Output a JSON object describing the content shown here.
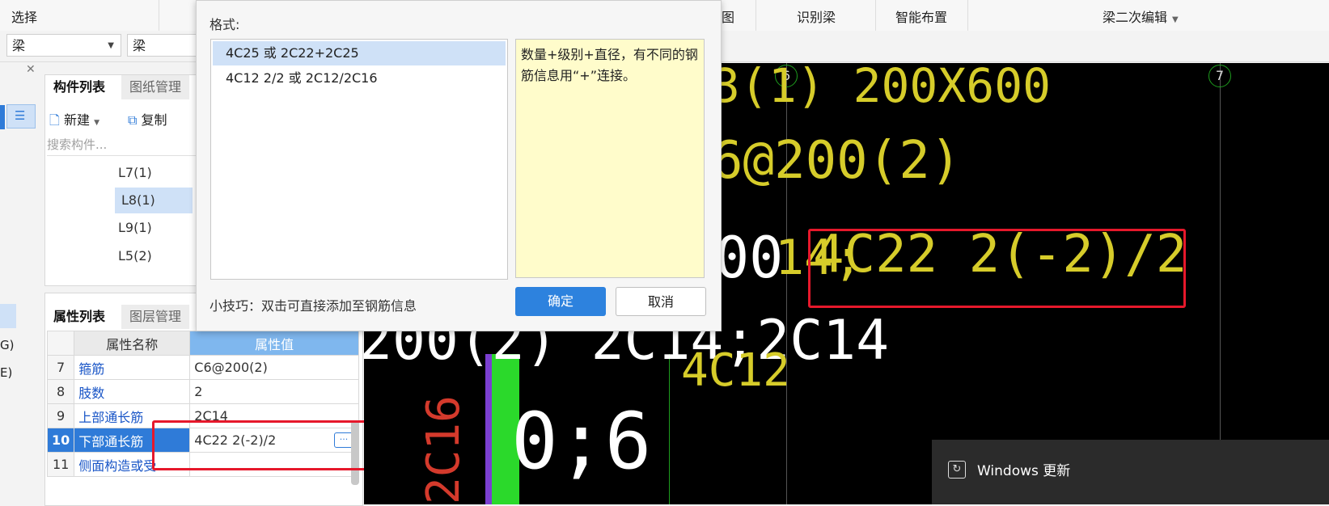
{
  "ribbon": {
    "select_label": "选择",
    "partial_label": "图",
    "identify_beam": "识别梁",
    "smart_layout": "智能布置",
    "beam_secondary_edit": "梁二次编辑"
  },
  "toolbar": {
    "combo1_value": "梁",
    "combo2_value": "梁"
  },
  "left_strip": {
    "text_g": "G)",
    "text_e": "E)"
  },
  "component_panel": {
    "tab_active": "构件列表",
    "tab_inactive": "图纸管理",
    "new_label": "新建",
    "copy_label": "复制",
    "search_placeholder": "搜索构件...",
    "items": [
      "L7(1)",
      "L8(1)",
      "L9(1)",
      "L5(2)"
    ],
    "selected_index": 1
  },
  "property_panel": {
    "tab_active": "属性列表",
    "tab_inactive": "图层管理",
    "col_name": "属性名称",
    "col_value": "属性值",
    "rows": [
      {
        "num": "7",
        "name": "箍筋",
        "value": "C6@200(2)"
      },
      {
        "num": "8",
        "name": "肢数",
        "value": "2"
      },
      {
        "num": "9",
        "name": "上部通长筋",
        "value": "2C14"
      },
      {
        "num": "10",
        "name": "下部通长筋",
        "value": "4C22 2(-2)/2"
      },
      {
        "num": "11",
        "name": "侧面构造或受",
        "value": ""
      }
    ],
    "ellipsis": "···"
  },
  "dialog": {
    "format_label": "格式:",
    "formats": [
      "4C25 或 2C22+2C25",
      "4C12 2/2 或 2C12/2C16"
    ],
    "selected_format": 0,
    "description": "数量+级别+直径，有不同的钢筋信息用“+”连接。",
    "tip": "小技巧：双击可直接添加至钢筋信息",
    "ok_label": "确定",
    "cancel_label": "取消"
  },
  "cad": {
    "axis6": "6",
    "axis7": "7",
    "line1": "3(1) 200X600",
    "line2": "6@200(2)",
    "line3_prefix": "00",
    "line3_mid": "14;",
    "line3_main": "4C22 2(-2)/2",
    "line4": "200(2) 2C14;2C14",
    "line4_sub": "4C12",
    "line5": "0;6",
    "vertical_label": "2C16"
  },
  "toast": {
    "title": "Windows 更新"
  }
}
